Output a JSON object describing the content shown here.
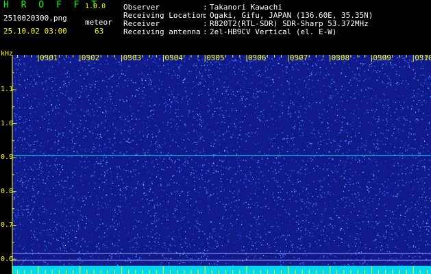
{
  "app": {
    "name": "H R O F F T",
    "version": "1.0.0"
  },
  "file": {
    "name": "2510020300.png",
    "datetime": "25.10.02 03:00"
  },
  "meteor": {
    "label": "meteor",
    "count": "63"
  },
  "info": [
    {
      "label": "Observer",
      "sep": ":",
      "value": "Takanori Kawachi"
    },
    {
      "label": "Receiving Location",
      "sep": ":",
      "value": "Ogaki, Gifu, JAPAN (136.60E, 35.35N)"
    },
    {
      "label": "Receiver",
      "sep": ":",
      "value": "R820T2(RTL-SDR) SDR-Sharp 53.372MHz"
    },
    {
      "label": "Receiving antenna",
      "sep": ":",
      "value": "2el-HB9CV Vertical (el. E-W)"
    }
  ],
  "spectrogram": {
    "y_unit": "kHz",
    "y_ticks": [
      "1.1",
      "1.0",
      "0.9",
      "0.8",
      "0.7",
      "0.6"
    ],
    "x_ticks": [
      "0301",
      "0302",
      "0303",
      "0304",
      "0305",
      "0306",
      "0307",
      "0308",
      "0309",
      "0310"
    ],
    "colors": {
      "background": "#101a8a",
      "noise": "#2e6cff",
      "signal": "#28e8ff",
      "axis": "#ffff00",
      "band": "#00d8f0"
    }
  }
}
